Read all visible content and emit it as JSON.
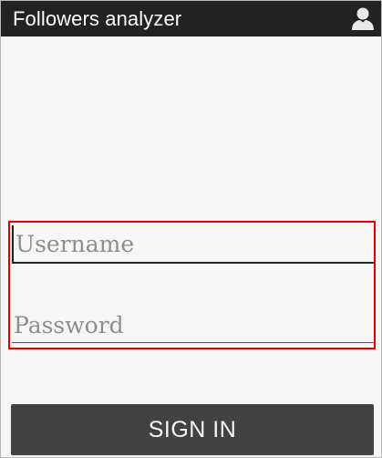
{
  "app_bar": {
    "title": "Followers analyzer",
    "icon": "profile-icon",
    "color": "#222222"
  },
  "login_form": {
    "highlight_color": "#dd0000",
    "username": {
      "value": "",
      "placeholder": "Username"
    },
    "password": {
      "value": "",
      "placeholder": "Password"
    }
  },
  "sign_in_button": {
    "label": "SIGN IN",
    "color": "#424242"
  }
}
